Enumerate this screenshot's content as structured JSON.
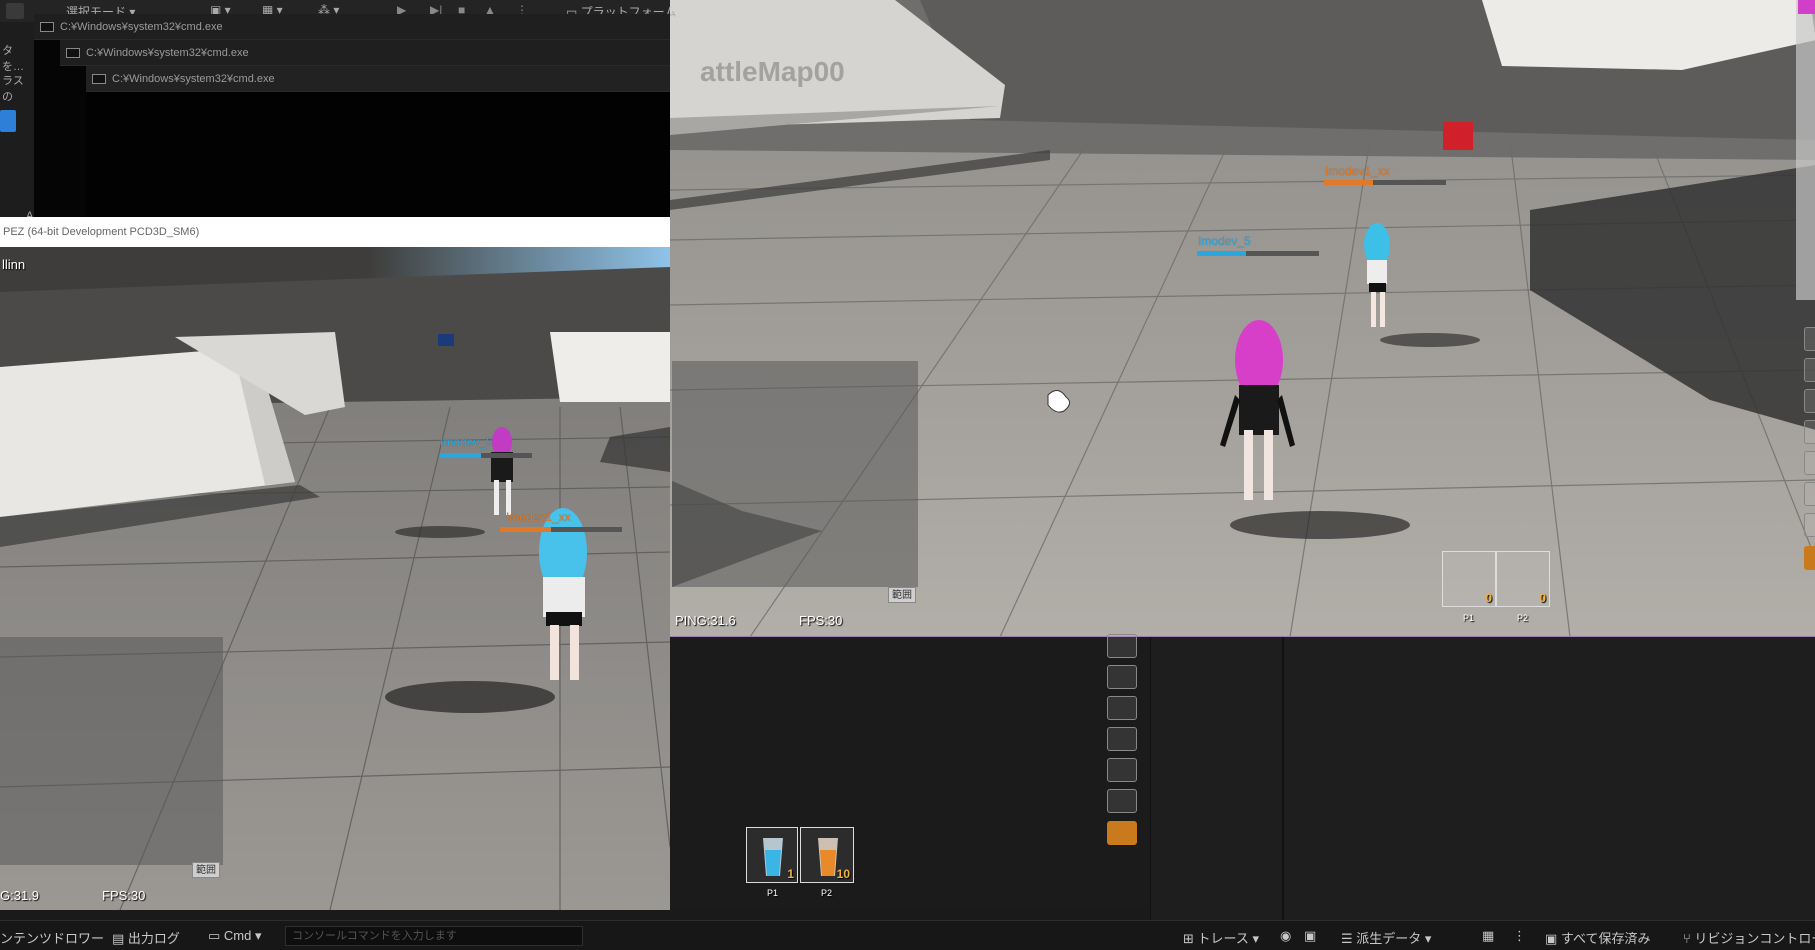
{
  "editor": {
    "toolbar": {
      "mode_label": "選択モード",
      "platform_label": "プラットフォーム"
    },
    "left_strip": {
      "label1": "タを…",
      "label2": "ラスの"
    }
  },
  "cmd_windows": [
    {
      "title": "C:¥Windows¥system32¥cmd.exe"
    },
    {
      "title": "C:¥Windows¥system32¥cmd.exe"
    },
    {
      "title": "C:¥Windows¥system32¥cmd.exe"
    }
  ],
  "game_left": {
    "window_title": "PEZ (64-bit Development PCD3D_SM6)",
    "top_text": "llinn",
    "ping_label": "G:31.9",
    "fps_label": "FPS:30",
    "range_button": "範囲",
    "players": [
      {
        "name": "Imodev_5",
        "color": "#29a8e0",
        "hp": 0.45
      },
      {
        "name": "Imodev1_xx",
        "color": "#e07a2a",
        "hp": 0.42
      }
    ],
    "slots": [
      {
        "label": "P1",
        "count": "1",
        "liquid": "#3ab6e6"
      },
      {
        "label": "P2",
        "count": "10",
        "liquid": "#e88a2a"
      }
    ]
  },
  "game_right": {
    "map_watermark": "attleMap00",
    "ping_label": "PING:31.6",
    "fps_label": "FPS:30",
    "range_button": "範囲",
    "players": [
      {
        "name": "Imodev_5",
        "color": "#29a8e0",
        "hp": 0.4
      },
      {
        "name": "Imodev1_xx",
        "color": "#e07a2a",
        "hp": 0.4
      }
    ],
    "slots": [
      {
        "label": "P1",
        "count": "0"
      },
      {
        "label": "P2",
        "count": "0"
      }
    ]
  },
  "statusbar": {
    "content_drawer": "ンテンツドロワー",
    "output_log": "出力ログ",
    "cmd": "Cmd",
    "console_placeholder": "コンソールコマンドを入力します",
    "trace": "トレース",
    "derived_data": "派生データ",
    "save_all": "すべて保存済み",
    "revision_control": "リビジョンコントロー"
  },
  "colors": {
    "accent_orange": "#c97a1d",
    "blue_team": "#29a8e0",
    "orange_team": "#e07a2a"
  }
}
